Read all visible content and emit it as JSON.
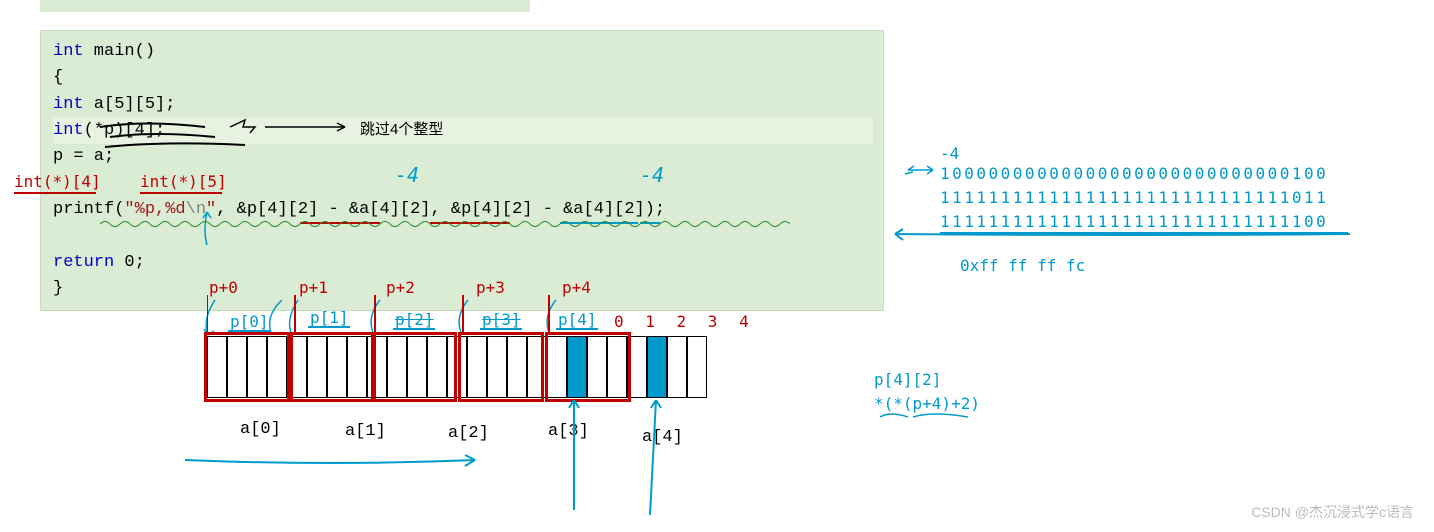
{
  "code": {
    "l1a": "int",
    "l1b": " main()",
    "l2": "{",
    "l3a": "    int",
    "l3b": " a[5][5];",
    "l4a": "    int",
    "l4b": "(*p)[4];",
    "l5": "    p = a;",
    "l6a": "    printf(",
    "l6b": "\"%p,%d",
    "l6c": "\\n",
    "l6d": "\"",
    "l6e": ", &p[4][2] - &a[4][2], &p[4][2] - &a[4][2]);",
    "l7a": "    return",
    "l7b": " 0;",
    "l8": "}"
  },
  "ann": {
    "skip4": "跳过4个整型",
    "intstar4": "int(*)[4]",
    "intstar5": "int(*)[5]",
    "minus4_1": "-4",
    "minus4_2": "-4",
    "p0": "p+0",
    "p1": "p+1",
    "p2": "p+2",
    "p3": "p+3",
    "p4": "p+4",
    "pi0": "p[0]",
    "pi1": "p[1]",
    "pi2": "p[2]",
    "pi3": "p[3]",
    "pi4": "p[4]",
    "a0": "a[0]",
    "a1": "a[1]",
    "a2": "a[2]",
    "a3": "a[3]",
    "a4": "a[4]",
    "idx": "0 1 2 3 4",
    "p42": "p[4][2]",
    "deref": "*(*(p+4)+2)"
  },
  "bits": {
    "neg4": "-4",
    "b1": "10000000000000000000000000000100",
    "b2": "11111111111111111111111111111011",
    "b3": "11111111111111111111111111111100",
    "hex": "0xff ff ff fc"
  },
  "watermark": "CSDN @杰沉浸式学c语言"
}
